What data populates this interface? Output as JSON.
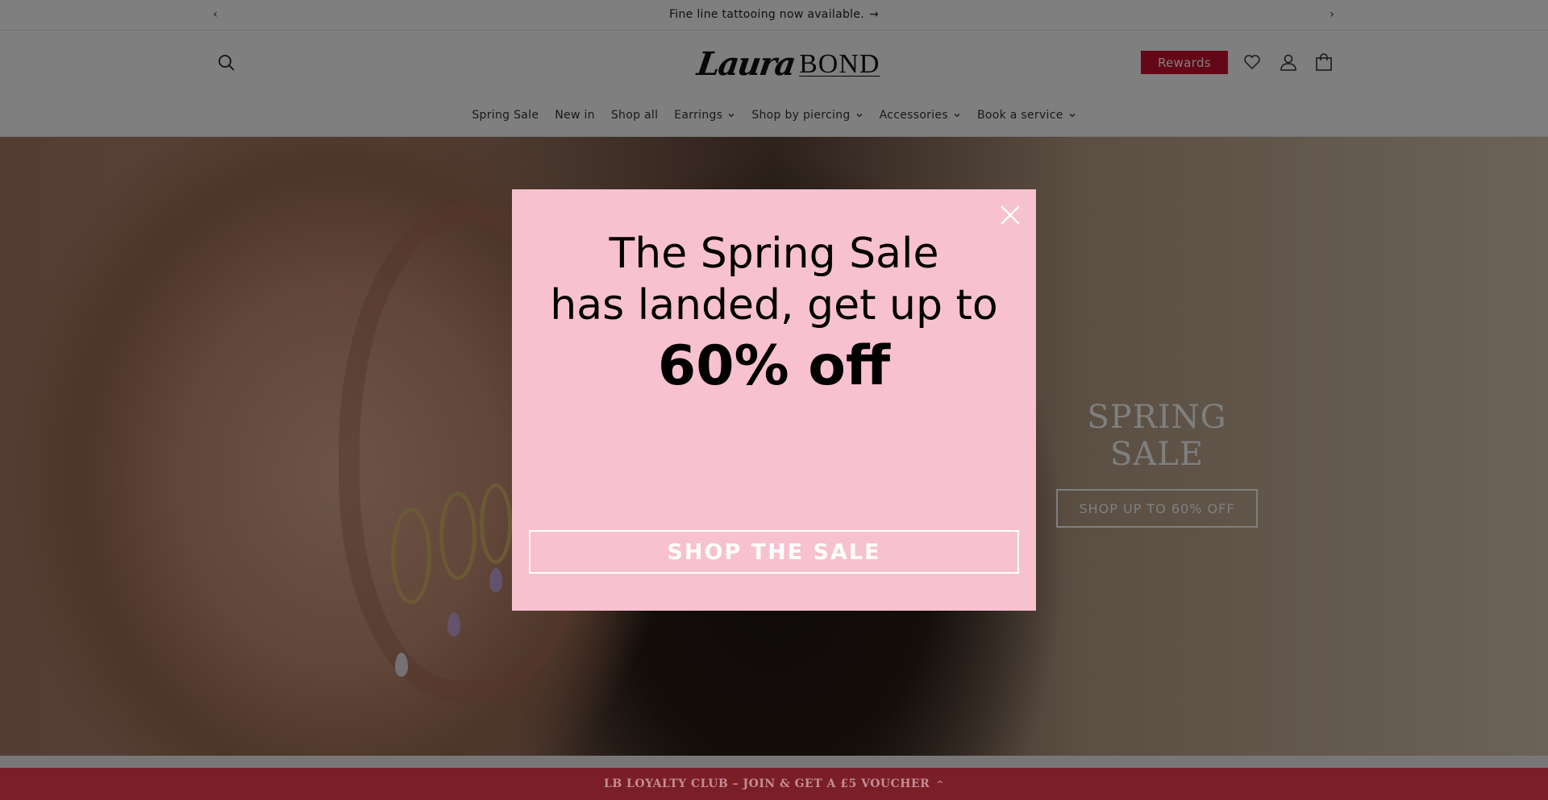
{
  "announcement": {
    "text": "Fine line tattooing now available.",
    "arrow": "→",
    "prev": "‹",
    "next": "›"
  },
  "header": {
    "logo_script": "Laura",
    "logo_word": "BOND",
    "rewards_label": "Rewards",
    "icons": [
      "search-icon",
      "heart-icon",
      "account-icon",
      "cart-icon"
    ]
  },
  "nav": {
    "items": [
      {
        "label": "Spring Sale"
      },
      {
        "label": "New in"
      },
      {
        "label": "Shop all"
      },
      {
        "label": "Earrings"
      },
      {
        "label": "Shop by piercing"
      },
      {
        "label": "Accessories"
      },
      {
        "label": "Book a service"
      }
    ]
  },
  "hero": {
    "title": "SPRING SALE",
    "button_label": "SHOP UP TO 60% OFF"
  },
  "popup": {
    "line1": "The Spring Sale",
    "line2": "has landed, get up to",
    "line3": "60% off",
    "cta_label": "SHOP THE SALE",
    "background": "#f8c1cf"
  },
  "loyalty": {
    "text": "LB LOYALTY CLUB – JOIN & GET A £5 VOUCHER",
    "caret": "^"
  },
  "colors": {
    "brand_red": "#c8102e",
    "loyalty_bg": "#7a1e27"
  }
}
